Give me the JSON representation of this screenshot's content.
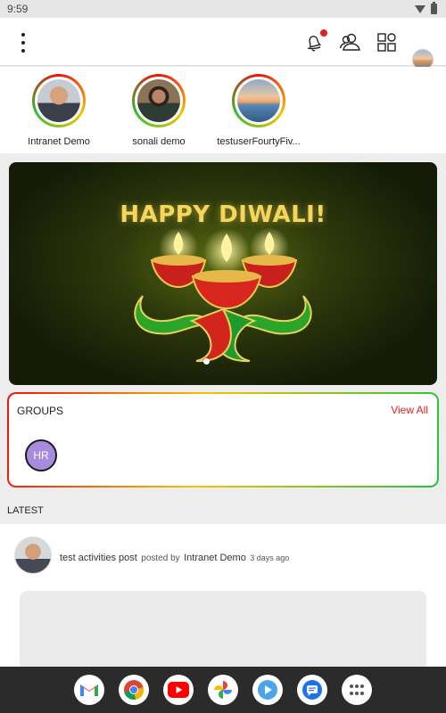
{
  "status_bar": {
    "time": "9:59"
  },
  "header": {
    "icons": [
      "menu-icon",
      "notification-bell-icon",
      "people-icon",
      "apps-grid-icon",
      "profile-avatar"
    ],
    "notification_dot_color": "#e02020"
  },
  "stories": [
    {
      "name": "Intranet Demo"
    },
    {
      "name": "sonali demo"
    },
    {
      "name": "testuserFourtyFiv..."
    }
  ],
  "banner": {
    "title": "HAPPY DIWALI!",
    "slides": 1,
    "active_slide": 1
  },
  "groups": {
    "title": "GROUPS",
    "view_all": "View All",
    "items": [
      {
        "initials": "HR",
        "color": "#a78bdc"
      }
    ]
  },
  "latest": {
    "label": "LATEST",
    "post": {
      "title": "test activities post",
      "by_text": "posted by",
      "author": "Intranet Demo",
      "time": "3 days ago"
    }
  },
  "dock": {
    "apps": [
      "gmail-icon",
      "chrome-icon",
      "youtube-icon",
      "photos-icon",
      "play-icon",
      "messages-icon",
      "app-drawer-icon"
    ]
  }
}
